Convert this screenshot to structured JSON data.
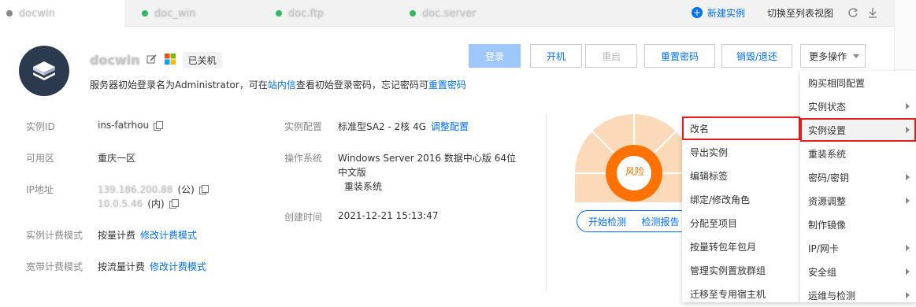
{
  "tabs": [
    {
      "name": "docwin",
      "dot_color": "#888888"
    },
    {
      "name": "doc_win",
      "dot_color": "#2fb95c"
    },
    {
      "name": "doc.ftp",
      "dot_color": "#2fb95c"
    },
    {
      "name": "doc.server",
      "dot_color": "#2fb95c"
    }
  ],
  "top_actions": {
    "new_instance": "新建实例",
    "switch_view": "切换至列表视图"
  },
  "instance": {
    "name": "docwin",
    "status": "已关机",
    "notice_prefix": "服务器初始登录名为Administrator，可在",
    "notice_link1": "站内信",
    "notice_middle": "查看初始登录密码，忘记密码可",
    "notice_link2": "重置密码"
  },
  "buttons": {
    "login": "登录",
    "start": "开机",
    "restart": "重启",
    "reset_password": "重置密码",
    "destroy": "销毁/退还",
    "more": "更多操作"
  },
  "details": {
    "id_label": "实例ID",
    "id_value": "ins-fatrhou",
    "zone_label": "可用区",
    "zone_value": "重庆一区",
    "ip_label": "IP地址",
    "ip_public": "139.186.200.88",
    "ip_public_suffix": "(公)",
    "ip_private": "10.0.5.46",
    "ip_private_suffix": "(内)",
    "billing_label": "实例计费模式",
    "billing_value": "按量计费",
    "billing_link": "修改计费模式",
    "bw_label": "宽带计费模式",
    "bw_value": "按流量计费",
    "bw_link": "修改计费模式",
    "config_label": "实例配置",
    "config_value": "标准型SA2 - 2核 4G",
    "config_link": "调整配置",
    "os_label": "操作系统",
    "os_value_line1": "Windows Server 2016 数据中心版 64位",
    "os_value_line2": "中文版",
    "os_link": "重装系统",
    "created_label": "创建时间",
    "created_value": "2021-12-21 15:13:47"
  },
  "risk": {
    "label": "风险",
    "start_check": "开始检测",
    "report": "检测报告"
  },
  "submenu": [
    "改名",
    "导出实例",
    "编辑标签",
    "绑定/修改角色",
    "分配至项目",
    "按量转包年包月",
    "管理实例置放群组",
    "迁移至专用宿主机"
  ],
  "more_menu": [
    {
      "label": "购买相同配置",
      "arrow": false
    },
    {
      "label": "实例状态",
      "arrow": true
    },
    {
      "label": "实例设置",
      "arrow": true
    },
    {
      "label": "重装系统",
      "arrow": false
    },
    {
      "label": "密码/密钥",
      "arrow": true
    },
    {
      "label": "资源调整",
      "arrow": true
    },
    {
      "label": "制作镜像",
      "arrow": false
    },
    {
      "label": "IP/网卡",
      "arrow": true
    },
    {
      "label": "安全组",
      "arrow": true
    },
    {
      "label": "运维与检测",
      "arrow": true
    }
  ],
  "colors": {
    "accent": "#006eff",
    "risk_orange": "#ff7200",
    "highlight_red": "#e02020"
  }
}
